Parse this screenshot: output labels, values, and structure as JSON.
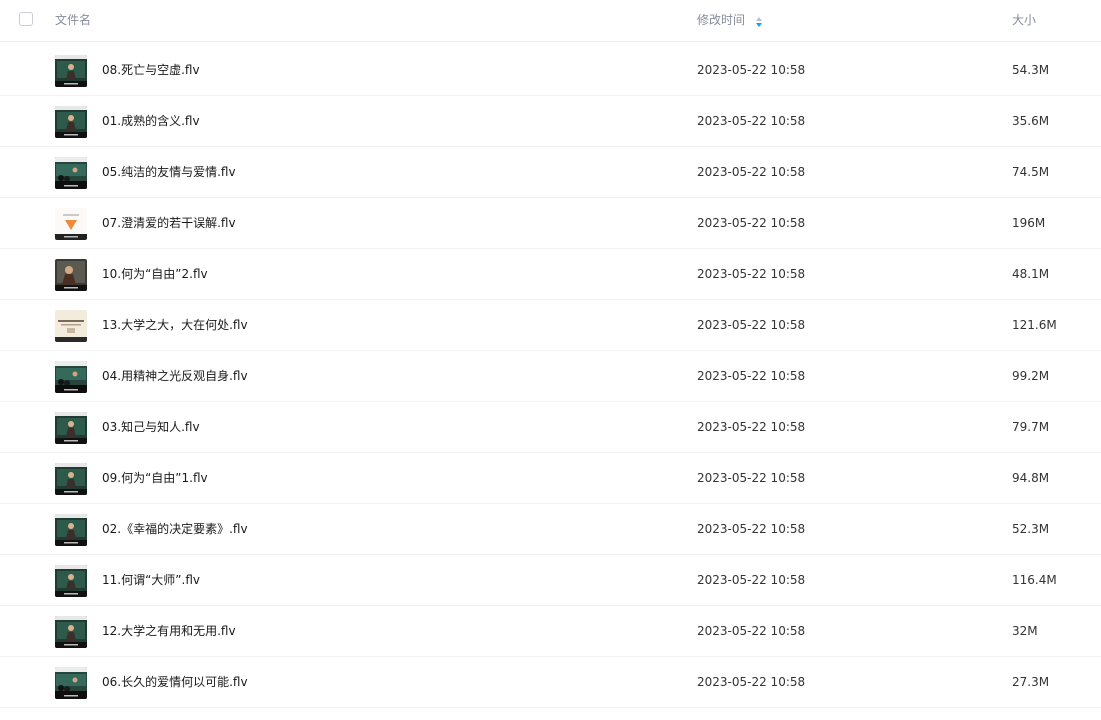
{
  "header": {
    "name_label": "文件名",
    "time_label": "修改时间",
    "size_label": "大小"
  },
  "files": [
    {
      "name": "08.死亡与空虚.flv",
      "time": "2023-05-22 10:58",
      "size": "54.3M",
      "thumb": "classroom-presenter"
    },
    {
      "name": "01.成熟的含义.flv",
      "time": "2023-05-22 10:58",
      "size": "35.6M",
      "thumb": "classroom-presenter"
    },
    {
      "name": "05.纯洁的友情与爱情.flv",
      "time": "2023-05-22 10:58",
      "size": "74.5M",
      "thumb": "classroom-audience"
    },
    {
      "name": "07.澄清爱的若干误解.flv",
      "time": "2023-05-22 10:58",
      "size": "196M",
      "thumb": "title-card-orange"
    },
    {
      "name": "10.何为“自由”2.flv",
      "time": "2023-05-22 10:58",
      "size": "48.1M",
      "thumb": "presenter-closeup"
    },
    {
      "name": "13.大学之大，大在何处.flv",
      "time": "2023-05-22 10:58",
      "size": "121.6M",
      "thumb": "slide-light"
    },
    {
      "name": "04.用精神之光反观自身.flv",
      "time": "2023-05-22 10:58",
      "size": "99.2M",
      "thumb": "classroom-audience"
    },
    {
      "name": "03.知己与知人.flv",
      "time": "2023-05-22 10:58",
      "size": "79.7M",
      "thumb": "classroom-presenter"
    },
    {
      "name": "09.何为“自由”1.flv",
      "time": "2023-05-22 10:58",
      "size": "94.8M",
      "thumb": "classroom-presenter"
    },
    {
      "name": "02.《幸福的决定要素》.flv",
      "time": "2023-05-22 10:58",
      "size": "52.3M",
      "thumb": "classroom-presenter"
    },
    {
      "name": "11.何谓“大师”.flv",
      "time": "2023-05-22 10:58",
      "size": "116.4M",
      "thumb": "classroom-presenter"
    },
    {
      "name": "12.大学之有用和无用.flv",
      "time": "2023-05-22 10:58",
      "size": "32M",
      "thumb": "classroom-presenter"
    },
    {
      "name": "06.长久的爱情何以可能.flv",
      "time": "2023-05-22 10:58",
      "size": "27.3M",
      "thumb": "classroom-audience"
    }
  ],
  "colors": {
    "sort_up": "#b9c0cc",
    "sort_down": "#06a7ff",
    "header_text": "#878c9c",
    "row_divider": "#f2f2f4"
  }
}
